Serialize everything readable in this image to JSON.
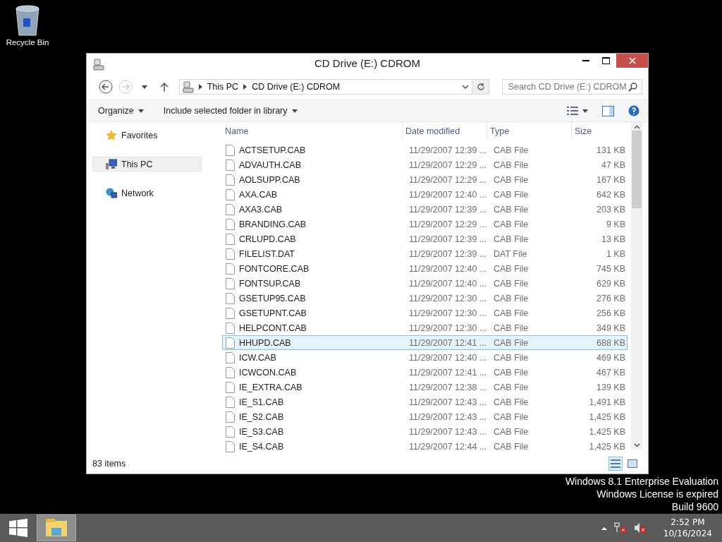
{
  "desktop": {
    "icons": [
      {
        "label": "Recycle Bin"
      }
    ],
    "watermark": [
      "Windows 8.1 Enterprise Evaluation",
      "Windows License is expired",
      "Build 9600"
    ]
  },
  "window": {
    "title": "CD Drive (E:) CDROM"
  },
  "address": {
    "crumbs": [
      "This PC",
      "CD Drive (E:) CDROM"
    ],
    "search_placeholder": "Search CD Drive (E:) CDROM"
  },
  "commands": [
    "Organize",
    "Include selected folder in library"
  ],
  "nav": [
    {
      "label": "Favorites",
      "kind": "favorites",
      "selected": false
    },
    {
      "label": "This PC",
      "kind": "pc",
      "selected": true
    },
    {
      "label": "Network",
      "kind": "network",
      "selected": false
    }
  ],
  "columns": [
    "Name",
    "Date modified",
    "Type",
    "Size"
  ],
  "rows": [
    {
      "name": "ACTSETUP.CAB",
      "date": "11/29/2007 12:39 ...",
      "type": "CAB File",
      "size": "131 KB",
      "selected": false
    },
    {
      "name": "ADVAUTH.CAB",
      "date": "11/29/2007 12:29 ...",
      "type": "CAB File",
      "size": "47 KB",
      "selected": false
    },
    {
      "name": "AOLSUPP.CAB",
      "date": "11/29/2007 12:29 ...",
      "type": "CAB File",
      "size": "167 KB",
      "selected": false
    },
    {
      "name": "AXA.CAB",
      "date": "11/29/2007 12:40 ...",
      "type": "CAB File",
      "size": "642 KB",
      "selected": false
    },
    {
      "name": "AXA3.CAB",
      "date": "11/29/2007 12:39 ...",
      "type": "CAB File",
      "size": "203 KB",
      "selected": false
    },
    {
      "name": "BRANDING.CAB",
      "date": "11/29/2007 12:29 ...",
      "type": "CAB File",
      "size": "9 KB",
      "selected": false
    },
    {
      "name": "CRLUPD.CAB",
      "date": "11/29/2007 12:39 ...",
      "type": "CAB File",
      "size": "13 KB",
      "selected": false
    },
    {
      "name": "FILELIST.DAT",
      "date": "11/29/2007 12:39 ...",
      "type": "DAT File",
      "size": "1 KB",
      "selected": false
    },
    {
      "name": "FONTCORE.CAB",
      "date": "11/29/2007 12:40 ...",
      "type": "CAB File",
      "size": "745 KB",
      "selected": false
    },
    {
      "name": "FONTSUP.CAB",
      "date": "11/29/2007 12:40 ...",
      "type": "CAB File",
      "size": "629 KB",
      "selected": false
    },
    {
      "name": "GSETUP95.CAB",
      "date": "11/29/2007 12:30 ...",
      "type": "CAB File",
      "size": "276 KB",
      "selected": false
    },
    {
      "name": "GSETUPNT.CAB",
      "date": "11/29/2007 12:30 ...",
      "type": "CAB File",
      "size": "256 KB",
      "selected": false
    },
    {
      "name": "HELPCONT.CAB",
      "date": "11/29/2007 12:30 ...",
      "type": "CAB File",
      "size": "349 KB",
      "selected": false
    },
    {
      "name": "HHUPD.CAB",
      "date": "11/29/2007 12:41 ...",
      "type": "CAB File",
      "size": "688 KB",
      "selected": true
    },
    {
      "name": "ICW.CAB",
      "date": "11/29/2007 12:40 ...",
      "type": "CAB File",
      "size": "469 KB",
      "selected": false
    },
    {
      "name": "ICWCON.CAB",
      "date": "11/29/2007 12:41 ...",
      "type": "CAB File",
      "size": "467 KB",
      "selected": false
    },
    {
      "name": "IE_EXTRA.CAB",
      "date": "11/29/2007 12:38 ...",
      "type": "CAB File",
      "size": "139 KB",
      "selected": false
    },
    {
      "name": "IE_S1.CAB",
      "date": "11/29/2007 12:43 ...",
      "type": "CAB File",
      "size": "1,491 KB",
      "selected": false
    },
    {
      "name": "IE_S2.CAB",
      "date": "11/29/2007 12:43 ...",
      "type": "CAB File",
      "size": "1,425 KB",
      "selected": false
    },
    {
      "name": "IE_S3.CAB",
      "date": "11/29/2007 12:43 ...",
      "type": "CAB File",
      "size": "1,425 KB",
      "selected": false
    },
    {
      "name": "IE_S4.CAB",
      "date": "11/29/2007 12:44 ...",
      "type": "CAB File",
      "size": "1,425 KB",
      "selected": false
    }
  ],
  "status_bar": {
    "count": "83 items"
  },
  "taskbar": {
    "time": "2:52 PM",
    "date": "10/16/2024"
  }
}
